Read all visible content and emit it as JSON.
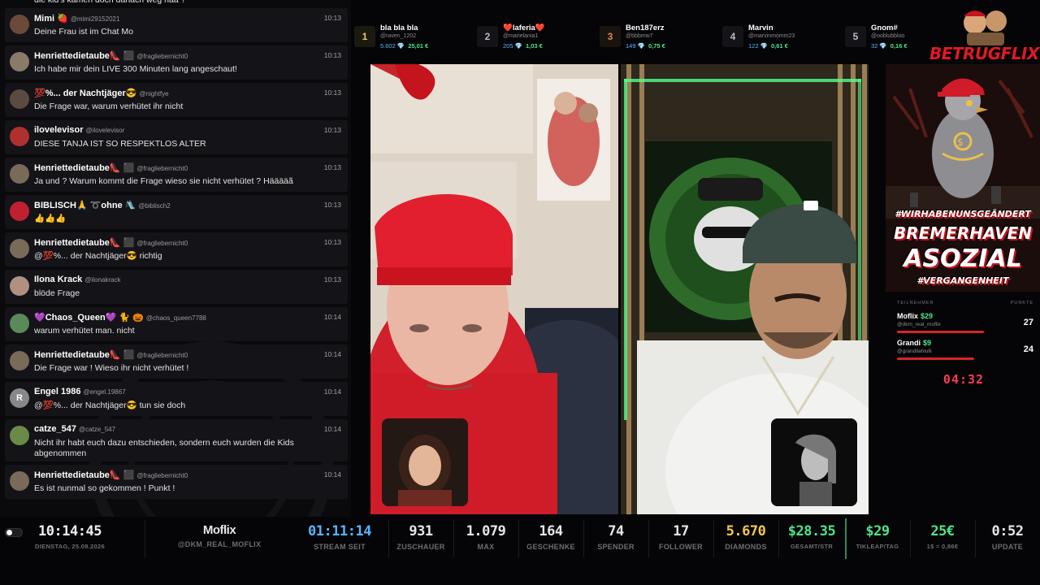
{
  "chat": {
    "partial_message": "die kid's kamen doch danach weg haa ?",
    "messages": [
      {
        "name": "Mimi 🍓",
        "handle": "@mimi29152021",
        "time": "10:13",
        "text": "Deine Frau ist im Chat Mo"
      },
      {
        "name": "Henriettedietaube👠 ⬛",
        "handle": "@fragliebernicht0",
        "time": "10:13",
        "text": "Ich habe mir dein LIVE 300 Minuten lang angeschaut!"
      },
      {
        "name": "💯%... der Nachtjäger😎",
        "handle": "@nightfye",
        "time": "10:13",
        "text": "Die Frage war, warum verhütet ihr nicht"
      },
      {
        "name": "ilovelevisor",
        "handle": "@ilovelevisor",
        "time": "10:13",
        "text": "DIESE TANJA IST SO RESPEKTLOS ALTER"
      },
      {
        "name": "Henriettedietaube👠 ⬛",
        "handle": "@fragliebernicht0",
        "time": "10:13",
        "text": "Ja und ? Warum kommt die Frage wieso sie nicht verhütet ? Hääääã"
      },
      {
        "name": "BIBLISCH🙏 ➰ohne 🛝",
        "handle": "@biblisch2",
        "time": "10:13",
        "text": "👍👍👍"
      },
      {
        "name": "Henriettedietaube👠 ⬛",
        "handle": "@fragliebernicht0",
        "time": "10:13",
        "text": "@💯%... der Nachtjäger😎 richtig"
      },
      {
        "name": "Ilona Krack",
        "handle": "@ilonakrack",
        "time": "10:13",
        "text": "blöde Frage"
      },
      {
        "name": "💜Chaos_Queen💜 🐈 🎃",
        "handle": "@chaos_queen7788",
        "time": "10:14",
        "text": "warum verhütet man. nicht"
      },
      {
        "name": "Henriettedietaube👠 ⬛",
        "handle": "@fragliebernicht0",
        "time": "10:14",
        "text": "Die Frage war ! Wieso ihr nicht verhütet !"
      },
      {
        "name": "Engel 1986",
        "handle": "@engel.19867",
        "time": "10:14",
        "text": "@💯%... der Nachtjäger😎 tun sie doch"
      },
      {
        "name": "catze_547",
        "handle": "@catze_547",
        "time": "10:14",
        "text": "Nicht ihr habt euch dazu entschieden, sondern euch wurden die Kids abgenommen"
      },
      {
        "name": "Henriettedietaube👠 ⬛",
        "handle": "@fragliebernicht0",
        "time": "10:14",
        "text": "Es ist nunmal so gekommen ! Punkt !"
      }
    ],
    "avatar_letter_engel": "R"
  },
  "leaderboard": [
    {
      "rank": "1",
      "name": "bla bla bla",
      "handle": "@raven_1202",
      "diamonds": "5.602 💎",
      "usd": "25,01 €"
    },
    {
      "rank": "2",
      "name": "❤️laferia❤️",
      "handle": "@marielania1",
      "diamonds": "205 💎",
      "usd": "1,03 €"
    },
    {
      "rank": "3",
      "name": "Ben187erz",
      "handle": "@bbbmw7",
      "diamonds": "149 💎",
      "usd": "0,75 €"
    },
    {
      "rank": "4",
      "name": "Marvin",
      "handle": "@marvinmomm23",
      "diamonds": "122 💎",
      "usd": "0,61 €"
    },
    {
      "rank": "5",
      "name": "Gnom#",
      "handle": "@ooblubbloo",
      "diamonds": "32 💎",
      "usd": "0,16 €"
    }
  ],
  "brand": {
    "logo_text": "BETRUGFLIX"
  },
  "banner": {
    "line1": "#WIRHABENUNSGEÄNDERT",
    "line2": "BREMERHAVEN",
    "line3": "ASOZIAL",
    "line4": "#VERGANGENHEIT"
  },
  "battle": {
    "header_left": "TEILNEHMER",
    "header_right": "PUNKTE",
    "players": [
      {
        "name": "Moflix",
        "amount": "$29",
        "handle": "@dkm_real_moflix",
        "points": "27",
        "bar_fraction": 0.92
      },
      {
        "name": "Grandi",
        "amount": "$9",
        "handle": "@grandilahlulli",
        "points": "24",
        "bar_fraction": 0.82
      }
    ],
    "timer": "04:32"
  },
  "status": {
    "clock": "10:14:45",
    "date": "DIENSTAG, 25.08.2026",
    "streamer": "Moflix",
    "streamer_handle": "@DKM_REAL_MOFLIX",
    "stream_time": "01:11:14",
    "stream_time_label": "STREAM SEIT",
    "viewers": "931",
    "viewers_label": "ZUSCHAUER",
    "max": "1.079",
    "max_label": "MAX",
    "gifts": "164",
    "gifts_label": "GESCHENKE",
    "donors": "74",
    "donors_label": "SPENDER",
    "followers": "17",
    "followers_label": "FOLLOWER",
    "diamonds": "5.670",
    "diamonds_label": "DIAMONDS",
    "total": "$28.35",
    "total_label": "GESAMT/STR",
    "tikleap": "$29",
    "tikleap_label": "TIKLEAP/TAG",
    "euro": "25€",
    "euro_label": "1$ = 0,86€",
    "update": "0:52",
    "update_label": "UPDATE"
  },
  "colors": {
    "accent_red": "#e01a24",
    "money_green": "#4fe38a",
    "timer_red": "#ff3b55",
    "clock_blue": "#5ab4ff",
    "diamond_gold": "#f2c94c"
  }
}
